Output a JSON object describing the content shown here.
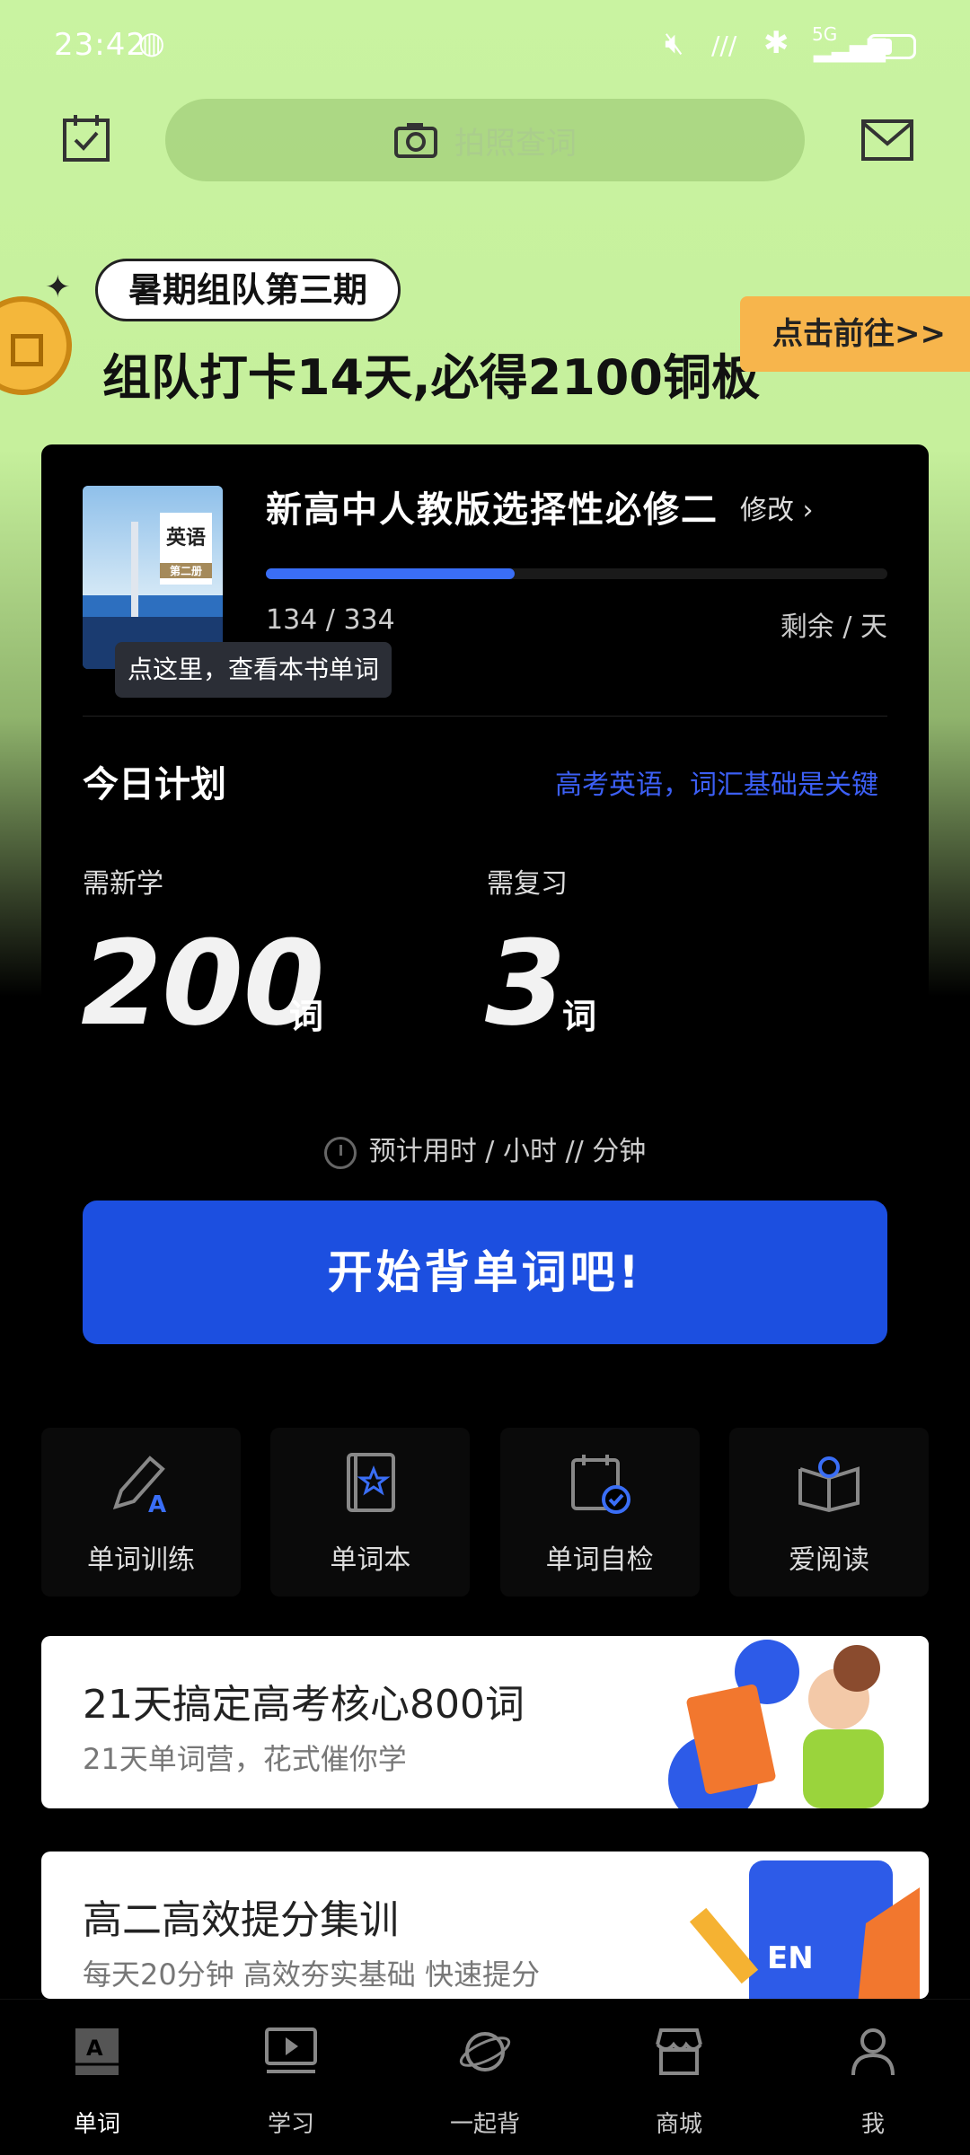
{
  "status": {
    "time": "23:42",
    "network": "5G"
  },
  "search": {
    "placeholder": "拍照查词"
  },
  "banner": {
    "pill": "暑期组队第三期",
    "title": "组队打卡14天,必得2100铜板",
    "button": "点击前往>>"
  },
  "book": {
    "cover_label": "英语",
    "cover_sub": "第二册",
    "title": "新高中人教版选择性必修二",
    "edit": "修改",
    "progress_text": "134 / 334",
    "progress": 0.4,
    "remaining": "剩余 / 天",
    "tooltip": "点这里，查看本书单词"
  },
  "plan": {
    "title": "今日计划",
    "slogan": "高考英语，词汇基础是关键",
    "new_label": "需新学",
    "new_count": "200",
    "review_label": "需复习",
    "review_count": "3",
    "unit": "词",
    "estimate": "预计用时 / 小时 // 分钟",
    "start": "开始背单词吧!"
  },
  "tools": [
    {
      "label": "单词训练",
      "icon": "pen-icon"
    },
    {
      "label": "单词本",
      "icon": "book-icon"
    },
    {
      "label": "单词自检",
      "icon": "calendar-check-icon"
    },
    {
      "label": "爱阅读",
      "icon": "reading-icon"
    }
  ],
  "promos": [
    {
      "title": "21天搞定高考核心800词",
      "subtitle": "21天单词营，花式催你学"
    },
    {
      "title": "高二高效提分集训",
      "subtitle": "每天20分钟 高效夯实基础 快速提分"
    }
  ],
  "tabs": [
    {
      "label": "单词",
      "icon": "word-icon"
    },
    {
      "label": "学习",
      "icon": "video-icon"
    },
    {
      "label": "一起背",
      "icon": "planet-icon"
    },
    {
      "label": "商城",
      "icon": "store-icon"
    },
    {
      "label": "我",
      "icon": "person-icon"
    }
  ],
  "colors": {
    "accent": "#1c4fe0",
    "banner_bg": "#c9f3a1",
    "button_orange": "#f7b54c"
  }
}
